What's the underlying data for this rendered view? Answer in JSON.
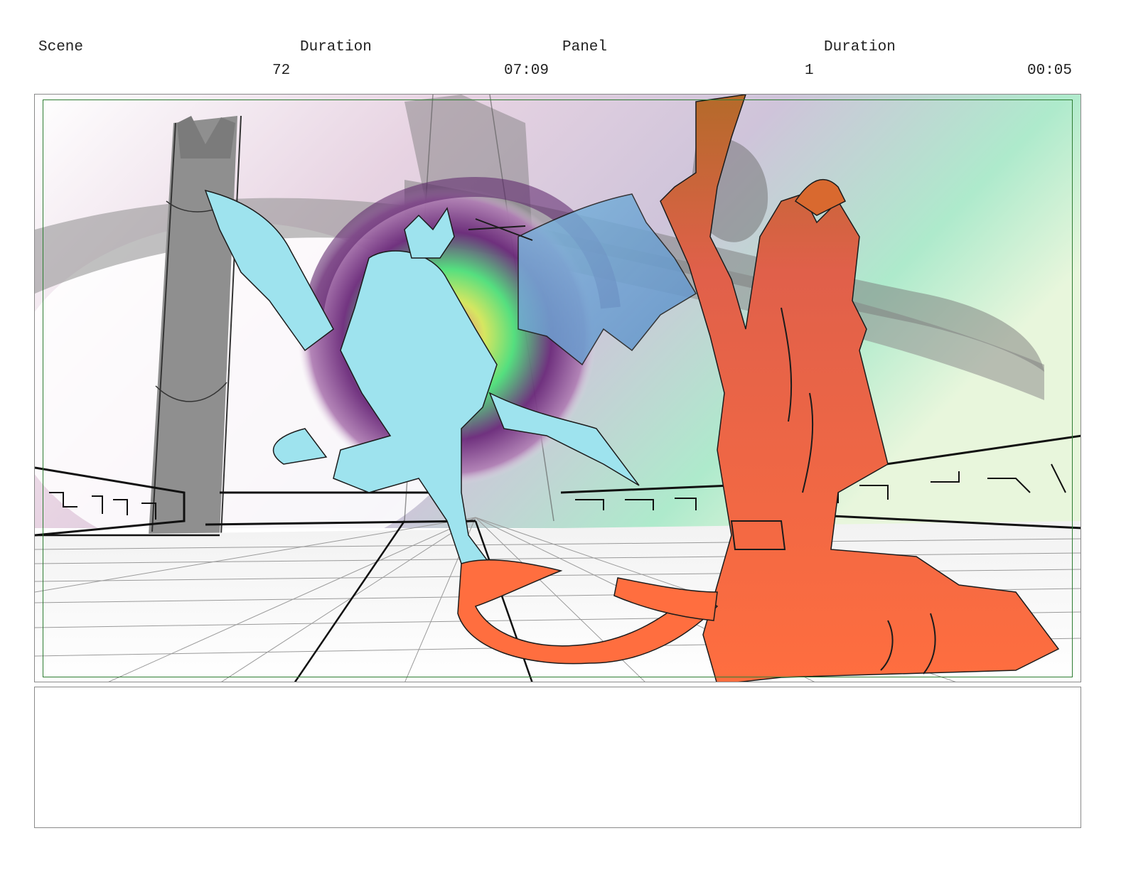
{
  "header": {
    "scene_label": "Scene",
    "duration_label_1": "Duration",
    "panel_label": "Panel",
    "duration_label_2": "Duration",
    "scene_value": "72",
    "scene_duration_value": "07:09",
    "panel_value": "1",
    "panel_duration_value": "00:05"
  },
  "notes": {
    "text": ""
  },
  "colors": {
    "safe_frame": "#2e7d32",
    "blue_figure": "#9ee3ee",
    "orange_figure": "#ff6e3f",
    "portal_outer": "#6b2a7a",
    "portal_inner": "#4ee07a"
  }
}
